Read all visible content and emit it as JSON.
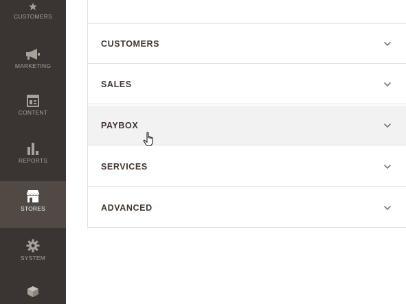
{
  "sidebar": {
    "items": [
      {
        "label": "CUSTOMERS",
        "icon": "customers-icon",
        "active": false
      },
      {
        "label": "MARKETING",
        "icon": "megaphone-icon",
        "active": false
      },
      {
        "label": "CONTENT",
        "icon": "layout-icon",
        "active": false
      },
      {
        "label": "REPORTS",
        "icon": "bar-chart-icon",
        "active": false
      },
      {
        "label": "STORES",
        "icon": "store-icon",
        "active": true
      },
      {
        "label": "SYSTEM",
        "icon": "gear-icon",
        "active": false
      },
      {
        "label": "",
        "icon": "cube-icon",
        "active": false
      }
    ]
  },
  "sections": [
    {
      "title": "CUSTOMERS",
      "expanded": false
    },
    {
      "title": "SALES",
      "expanded": false
    },
    {
      "title": "PAYBOX",
      "expanded": false,
      "hovered": true
    },
    {
      "title": "SERVICES",
      "expanded": false
    },
    {
      "title": "ADVANCED",
      "expanded": false
    }
  ],
  "colors": {
    "sidebar_bg": "#3a3533",
    "sidebar_active_bg": "#514943",
    "sidebar_text": "#a7a09b",
    "section_title": "#41362f",
    "section_hover_bg": "#f2f2f2",
    "divider": "#e3e3e3"
  }
}
